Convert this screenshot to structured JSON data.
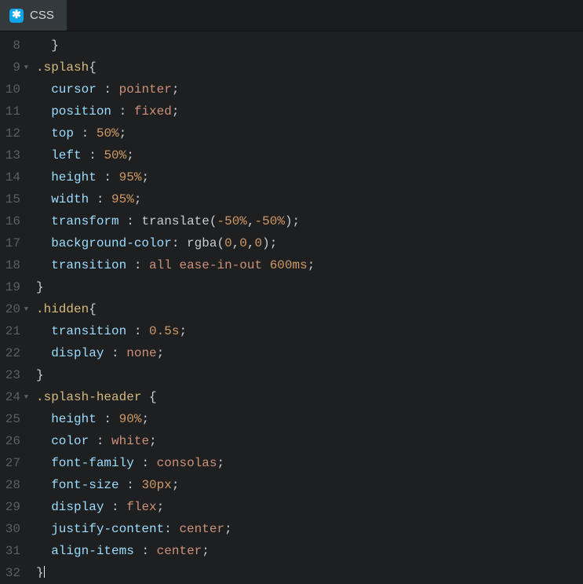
{
  "tab": {
    "label": "CSS",
    "icon_char": "✱"
  },
  "gutter": {
    "start": 8,
    "end": 32,
    "fold_lines": [
      9,
      20,
      24
    ]
  },
  "code_lines": [
    [
      [
        "plain",
        "  "
      ],
      [
        "punc",
        "}"
      ]
    ],
    [
      [
        "sel",
        ".splash"
      ],
      [
        "punc",
        "{"
      ]
    ],
    [
      [
        "plain",
        "  "
      ],
      [
        "prop",
        "cursor"
      ],
      [
        "plain",
        " "
      ],
      [
        "punc",
        ":"
      ],
      [
        "plain",
        " "
      ],
      [
        "val",
        "pointer"
      ],
      [
        "punc",
        ";"
      ]
    ],
    [
      [
        "plain",
        "  "
      ],
      [
        "prop",
        "position"
      ],
      [
        "plain",
        " "
      ],
      [
        "punc",
        ":"
      ],
      [
        "plain",
        " "
      ],
      [
        "val",
        "fixed"
      ],
      [
        "punc",
        ";"
      ]
    ],
    [
      [
        "plain",
        "  "
      ],
      [
        "prop",
        "top"
      ],
      [
        "plain",
        " "
      ],
      [
        "punc",
        ":"
      ],
      [
        "plain",
        " "
      ],
      [
        "num",
        "50"
      ],
      [
        "unit",
        "%"
      ],
      [
        "punc",
        ";"
      ]
    ],
    [
      [
        "plain",
        "  "
      ],
      [
        "prop",
        "left"
      ],
      [
        "plain",
        " "
      ],
      [
        "punc",
        ":"
      ],
      [
        "plain",
        " "
      ],
      [
        "num",
        "50"
      ],
      [
        "unit",
        "%"
      ],
      [
        "punc",
        ";"
      ]
    ],
    [
      [
        "plain",
        "  "
      ],
      [
        "prop",
        "height"
      ],
      [
        "plain",
        " "
      ],
      [
        "punc",
        ":"
      ],
      [
        "plain",
        " "
      ],
      [
        "num",
        "95"
      ],
      [
        "unit",
        "%"
      ],
      [
        "punc",
        ";"
      ]
    ],
    [
      [
        "plain",
        "  "
      ],
      [
        "prop",
        "width"
      ],
      [
        "plain",
        " "
      ],
      [
        "punc",
        ":"
      ],
      [
        "plain",
        " "
      ],
      [
        "num",
        "95"
      ],
      [
        "unit",
        "%"
      ],
      [
        "punc",
        ";"
      ]
    ],
    [
      [
        "plain",
        "  "
      ],
      [
        "prop",
        "transform"
      ],
      [
        "plain",
        " "
      ],
      [
        "punc",
        ":"
      ],
      [
        "plain",
        " "
      ],
      [
        "func",
        "translate"
      ],
      [
        "punc",
        "("
      ],
      [
        "num",
        "-50"
      ],
      [
        "unit",
        "%"
      ],
      [
        "punc",
        ","
      ],
      [
        "num",
        "-50"
      ],
      [
        "unit",
        "%"
      ],
      [
        "punc",
        ")"
      ],
      [
        "punc",
        ";"
      ]
    ],
    [
      [
        "plain",
        "  "
      ],
      [
        "prop",
        "background-color"
      ],
      [
        "punc",
        ":"
      ],
      [
        "plain",
        " "
      ],
      [
        "func",
        "rgba"
      ],
      [
        "punc",
        "("
      ],
      [
        "num",
        "0"
      ],
      [
        "punc",
        ","
      ],
      [
        "num",
        "0"
      ],
      [
        "punc",
        ","
      ],
      [
        "num",
        "0"
      ],
      [
        "punc",
        ")"
      ],
      [
        "punc",
        ";"
      ]
    ],
    [
      [
        "plain",
        "  "
      ],
      [
        "prop",
        "transition"
      ],
      [
        "plain",
        " "
      ],
      [
        "punc",
        ":"
      ],
      [
        "plain",
        " "
      ],
      [
        "val",
        "all"
      ],
      [
        "plain",
        " "
      ],
      [
        "val",
        "ease-in-out"
      ],
      [
        "plain",
        " "
      ],
      [
        "num",
        "600"
      ],
      [
        "unit",
        "ms"
      ],
      [
        "punc",
        ";"
      ]
    ],
    [
      [
        "punc",
        "}"
      ]
    ],
    [
      [
        "sel",
        ".hidden"
      ],
      [
        "punc",
        "{"
      ]
    ],
    [
      [
        "plain",
        "  "
      ],
      [
        "prop",
        "transition"
      ],
      [
        "plain",
        " "
      ],
      [
        "punc",
        ":"
      ],
      [
        "plain",
        " "
      ],
      [
        "num",
        "0.5"
      ],
      [
        "unit",
        "s"
      ],
      [
        "punc",
        ";"
      ]
    ],
    [
      [
        "plain",
        "  "
      ],
      [
        "prop",
        "display"
      ],
      [
        "plain",
        " "
      ],
      [
        "punc",
        ":"
      ],
      [
        "plain",
        " "
      ],
      [
        "val",
        "none"
      ],
      [
        "punc",
        ";"
      ]
    ],
    [
      [
        "punc",
        "}"
      ]
    ],
    [
      [
        "sel",
        ".splash-header"
      ],
      [
        "plain",
        " "
      ],
      [
        "punc",
        "{"
      ]
    ],
    [
      [
        "plain",
        "  "
      ],
      [
        "prop",
        "height"
      ],
      [
        "plain",
        " "
      ],
      [
        "punc",
        ":"
      ],
      [
        "plain",
        " "
      ],
      [
        "num",
        "90"
      ],
      [
        "unit",
        "%"
      ],
      [
        "punc",
        ";"
      ]
    ],
    [
      [
        "plain",
        "  "
      ],
      [
        "prop",
        "color"
      ],
      [
        "plain",
        " "
      ],
      [
        "punc",
        ":"
      ],
      [
        "plain",
        " "
      ],
      [
        "val",
        "white"
      ],
      [
        "punc",
        ";"
      ]
    ],
    [
      [
        "plain",
        "  "
      ],
      [
        "prop",
        "font-family"
      ],
      [
        "plain",
        " "
      ],
      [
        "punc",
        ":"
      ],
      [
        "plain",
        " "
      ],
      [
        "val",
        "consolas"
      ],
      [
        "punc",
        ";"
      ]
    ],
    [
      [
        "plain",
        "  "
      ],
      [
        "prop",
        "font-size"
      ],
      [
        "plain",
        " "
      ],
      [
        "punc",
        ":"
      ],
      [
        "plain",
        " "
      ],
      [
        "num",
        "30"
      ],
      [
        "unit",
        "px"
      ],
      [
        "punc",
        ";"
      ]
    ],
    [
      [
        "plain",
        "  "
      ],
      [
        "prop",
        "display"
      ],
      [
        "plain",
        " "
      ],
      [
        "punc",
        ":"
      ],
      [
        "plain",
        " "
      ],
      [
        "val",
        "flex"
      ],
      [
        "punc",
        ";"
      ]
    ],
    [
      [
        "plain",
        "  "
      ],
      [
        "prop",
        "justify-content"
      ],
      [
        "punc",
        ":"
      ],
      [
        "plain",
        " "
      ],
      [
        "val",
        "center"
      ],
      [
        "punc",
        ";"
      ]
    ],
    [
      [
        "plain",
        "  "
      ],
      [
        "prop",
        "align-items"
      ],
      [
        "plain",
        " "
      ],
      [
        "punc",
        ":"
      ],
      [
        "plain",
        " "
      ],
      [
        "val",
        "center"
      ],
      [
        "punc",
        ";"
      ]
    ],
    [
      [
        "punc",
        "}"
      ],
      [
        "cursor",
        ""
      ]
    ]
  ]
}
